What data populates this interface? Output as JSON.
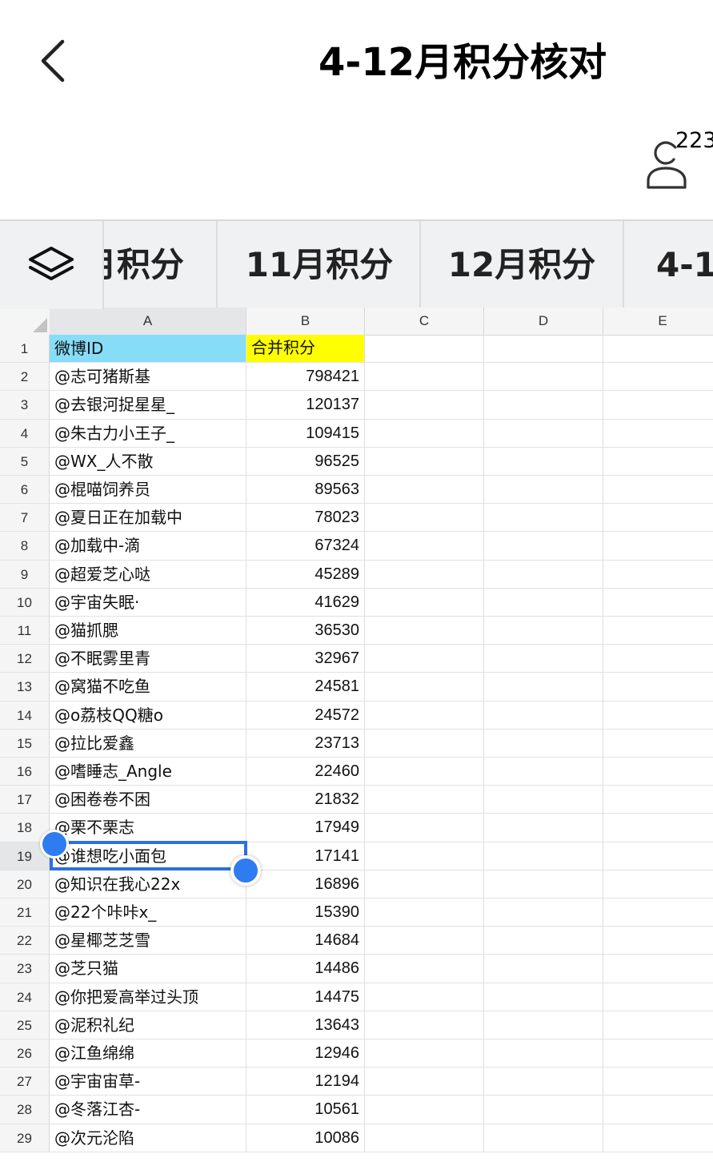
{
  "header": {
    "back_label": "back",
    "title": "4-12月积分核对",
    "collaborator_count": "223"
  },
  "tabs": [
    {
      "label": "月积分"
    },
    {
      "label": "11月积分"
    },
    {
      "label": "12月积分"
    },
    {
      "label": "4-1"
    }
  ],
  "grid": {
    "columns": [
      "A",
      "B",
      "C",
      "D",
      "E"
    ],
    "header_row": {
      "num": "1",
      "a": "微博ID",
      "b": "合并积分",
      "a_bg": "#87dcf8",
      "b_bg": "#ffff00"
    },
    "selected_cell": "A19",
    "selection_color": "#2f6fdf",
    "rows": [
      {
        "num": "2",
        "a": "@志可猪斯基",
        "b": "798421"
      },
      {
        "num": "3",
        "a": "@去银河捉星星_",
        "b": "120137"
      },
      {
        "num": "4",
        "a": "@朱古力小王子_",
        "b": "109415"
      },
      {
        "num": "5",
        "a": "@WX_人不散",
        "b": "96525"
      },
      {
        "num": "6",
        "a": "@棍喵饲养员",
        "b": "89563"
      },
      {
        "num": "7",
        "a": "@夏日正在加载中",
        "b": "78023"
      },
      {
        "num": "8",
        "a": "@加载中-滴",
        "b": "67324"
      },
      {
        "num": "9",
        "a": "@超爱芝心哒",
        "b": "45289"
      },
      {
        "num": "10",
        "a": "@宇宙失眠·",
        "b": "41629"
      },
      {
        "num": "11",
        "a": "@猫抓腮",
        "b": "36530"
      },
      {
        "num": "12",
        "a": "@不眠雾里青",
        "b": "32967"
      },
      {
        "num": "13",
        "a": "@窝猫不吃鱼",
        "b": "24581"
      },
      {
        "num": "14",
        "a": "@o荔枝QQ糖o",
        "b": "24572"
      },
      {
        "num": "15",
        "a": "@拉比爱鑫",
        "b": "23713"
      },
      {
        "num": "16",
        "a": "@嗜睡志_Angle",
        "b": "22460"
      },
      {
        "num": "17",
        "a": "@困卷卷不困",
        "b": "21832"
      },
      {
        "num": "18",
        "a": "@栗不栗志",
        "b": "17949"
      },
      {
        "num": "19",
        "a": "@谁想吃小面包",
        "b": "17141"
      },
      {
        "num": "20",
        "a": "@知识在我心22x",
        "b": "16896"
      },
      {
        "num": "21",
        "a": "@22个咔咔x_",
        "b": "15390"
      },
      {
        "num": "22",
        "a": "@星椰芝芝雪",
        "b": "14684"
      },
      {
        "num": "23",
        "a": "@芝只猫",
        "b": "14486"
      },
      {
        "num": "24",
        "a": "@你把爱高举过头顶",
        "b": "14475"
      },
      {
        "num": "25",
        "a": "@泥积礼纪",
        "b": "13643"
      },
      {
        "num": "26",
        "a": "@江鱼绵绵",
        "b": "12946"
      },
      {
        "num": "27",
        "a": "@宇宙宙草-",
        "b": "12194"
      },
      {
        "num": "28",
        "a": "@冬落江杏-",
        "b": "10561"
      },
      {
        "num": "29",
        "a": "@次元沦陷",
        "b": "10086"
      }
    ]
  }
}
